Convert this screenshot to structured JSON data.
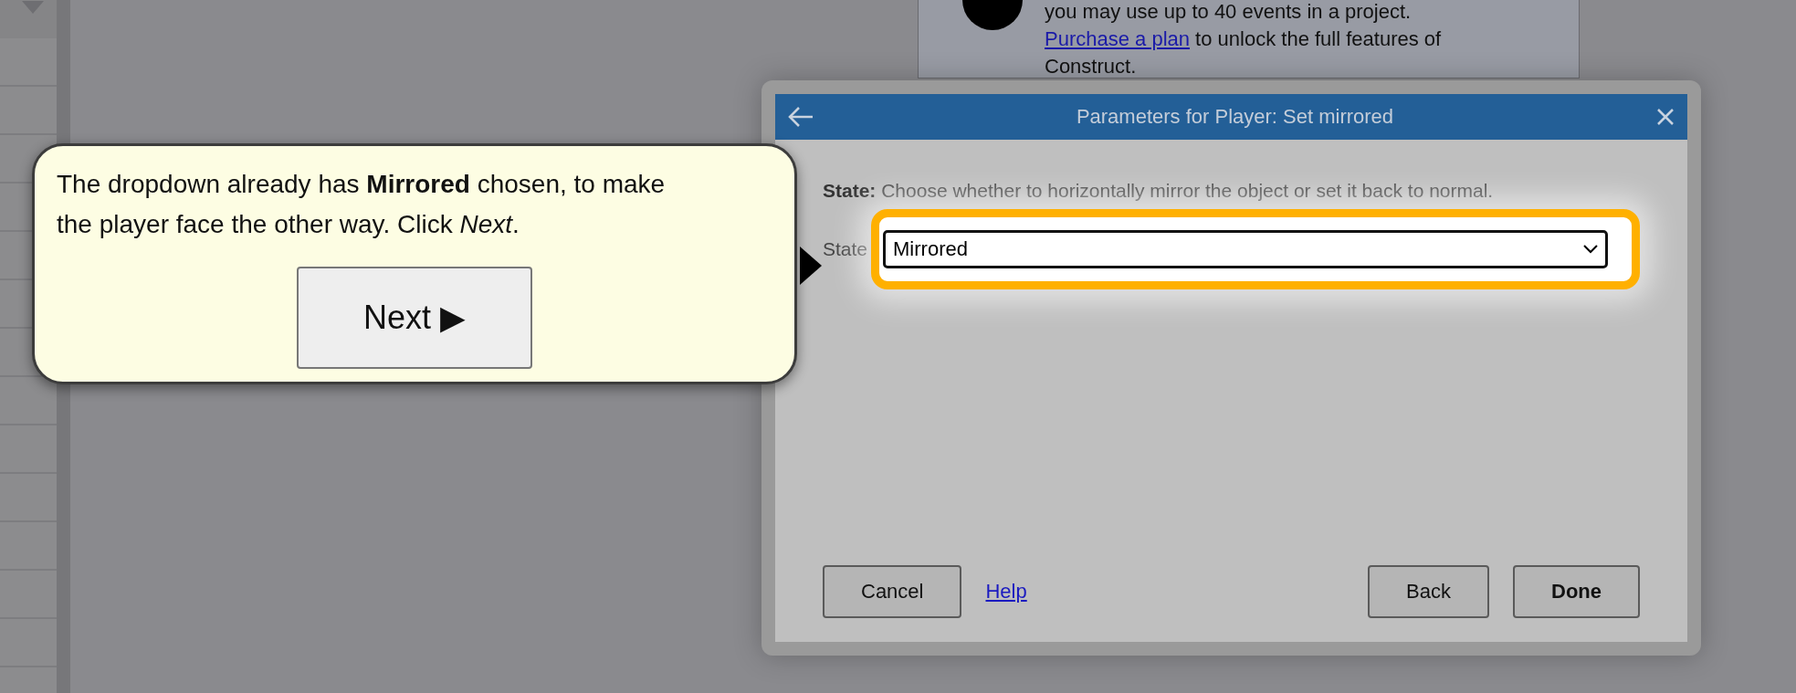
{
  "notice": {
    "text": "you may use up to 40 events in a project.",
    "link": "Purchase a plan",
    "text_after": "to unlock the full features of Construct."
  },
  "dialog": {
    "title": "Parameters for Player: Set mirrored",
    "description": "**State:** Choose whether to horizontally mirror the object or set it back to normal.",
    "field": {
      "label": "State",
      "value": "Mirrored",
      "highlighted": true
    },
    "buttons": [
      {
        "label": "Cancel",
        "kind": "button",
        "default": false
      },
      {
        "label": "Help",
        "kind": "link"
      },
      {
        "label": "Back",
        "kind": "button",
        "default": false
      },
      {
        "label": "Done",
        "kind": "button",
        "default": true
      }
    ]
  },
  "tutorial": {
    "text": "The dropdown already has **Mirrored** chosen, to make the player face the other way. Click *Next*.",
    "button": "Next ▶"
  }
}
